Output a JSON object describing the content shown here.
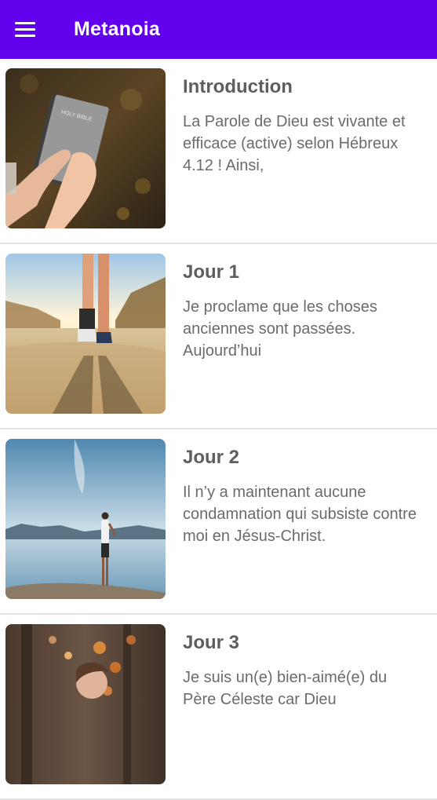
{
  "app": {
    "title": "Metanoia"
  },
  "icons": {
    "menu": "menu-icon"
  },
  "colors": {
    "appbar": "#6200ee",
    "divider": "#e3e3e3"
  },
  "items": [
    {
      "title": "Introduction",
      "excerpt": "La Parole de Dieu est vivante et efficace (active) selon Hébreux 4.12 ! Ainsi,",
      "image": "hands-holding-bible"
    },
    {
      "title": "Jour 1",
      "excerpt": "Je proclame que les choses anciennes sont passées. Aujourd’hui",
      "image": "person-walking-road"
    },
    {
      "title": "Jour 2",
      "excerpt": "Il n’y a maintenant aucune condamnation qui subsiste contre moi en Jésus-Christ.",
      "image": "man-standing-by-lake"
    },
    {
      "title": "Jour 3",
      "excerpt": "Je suis un(e) bien-aimé(e) du Père Céleste car Dieu",
      "image": "woman-autumn-leaves"
    }
  ]
}
